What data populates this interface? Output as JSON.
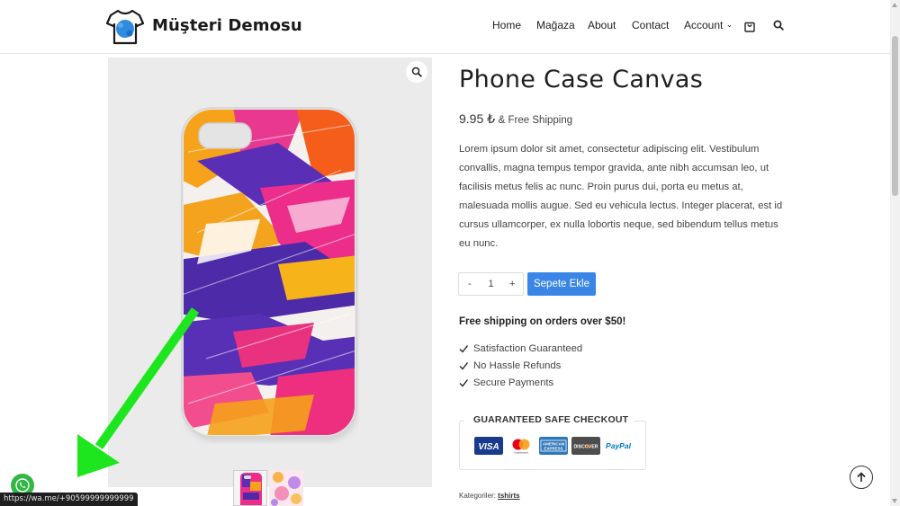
{
  "header": {
    "brand": "Müşteri Demosu",
    "nav": [
      "Home",
      "Mağaza",
      "About",
      "Contact",
      "Account"
    ],
    "account_caret": "⌄"
  },
  "product": {
    "title": "Phone Case Canvas",
    "price": "9.95 ₺",
    "shipping_note": "& Free Shipping",
    "description": "Lorem ipsum dolor sit amet, consectetur adipiscing elit. Vestibulum convallis, magna tempus tempor gravida, ante nibh accumsan leo, ut facilisis metus felis ac nunc. Proin purus dui, porta eu metus at, malesuada mollis augue. Sed eu vehicula lectus. Integer placerat, est id cursus ullamcorper, ex nulla lobortis neque, sed bibendum tellus metus eu nunc.",
    "quantity": {
      "minus": "-",
      "value": "1",
      "plus": "+"
    },
    "add_to_cart": "Sepete Ekle",
    "free_shipping_banner": "Free shipping on orders over $50!",
    "features": [
      "Satisfaction Guaranteed",
      "No Hassle Refunds",
      "Secure Payments"
    ],
    "checkout_title": "GUARANTEED SAFE CHECKOUT",
    "payment_methods": [
      "VISA",
      "Mastercard",
      "American Express",
      "DISCOVER",
      "PayPal"
    ],
    "categories_label": "Kategoriler:",
    "category": "tshirts"
  },
  "payment_text": {
    "visa": "VISA",
    "amex_top": "AMERICAN",
    "amex_bottom": "EXPRESS",
    "discover": "DISCOVER",
    "paypal": "PayPal",
    "mastercard_caption": "mastercard"
  },
  "status_bar": {
    "url": "https://wa.me/+90599999999999"
  },
  "colors": {
    "accent": "#3a86e6",
    "whatsapp": "#2fb843",
    "annotation_arrow": "#1ee61e"
  }
}
